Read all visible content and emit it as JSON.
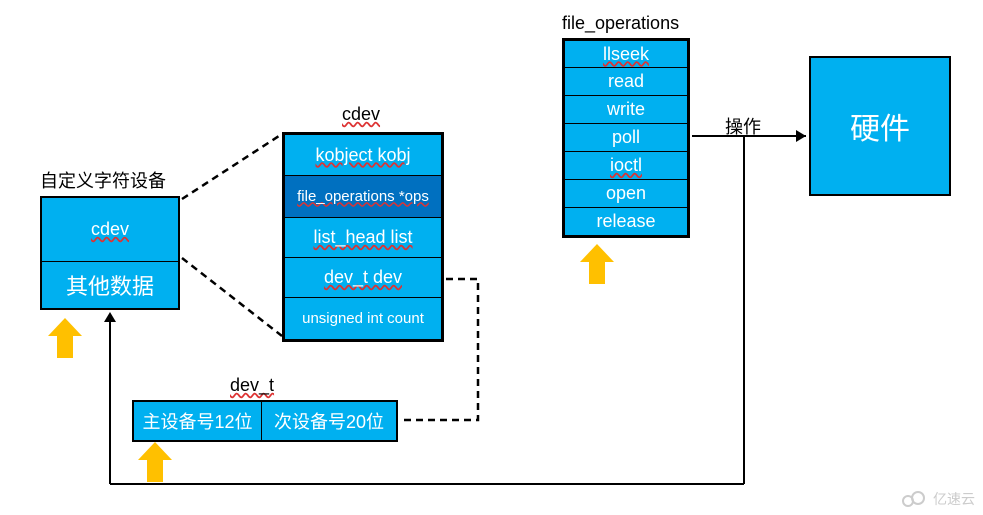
{
  "custom_dev": {
    "title": "自定义字符设备",
    "rows": [
      "cdev",
      "其他数据"
    ]
  },
  "cdev_struct": {
    "title": "cdev",
    "rows": [
      "kobject kobj",
      "file_operations *ops",
      "list_head list",
      "dev_t dev",
      "unsigned int count"
    ]
  },
  "dev_t": {
    "title": "dev_t",
    "cells": [
      "主设备号12位",
      "次设备号20位"
    ]
  },
  "fops": {
    "title": "file_operations",
    "rows": [
      "llseek",
      "read",
      "write",
      "poll",
      "ioctl",
      "open",
      "release"
    ]
  },
  "op_label": "操作",
  "hw_label": "硬件",
  "watermark": "亿速云"
}
